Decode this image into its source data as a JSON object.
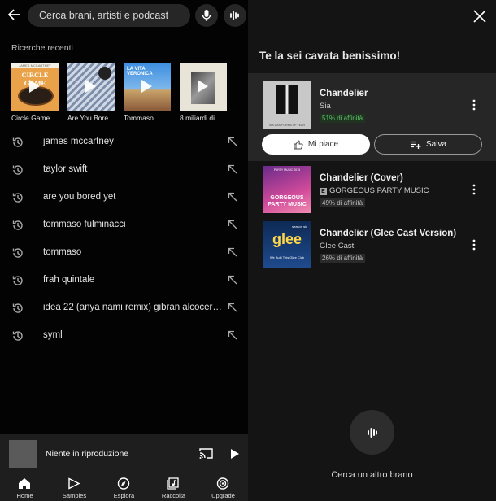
{
  "search": {
    "placeholder": "Cerca brani, artisti e podcast"
  },
  "recent": {
    "title": "Ricerche recenti",
    "albums": [
      {
        "label": "Circle Game",
        "cover_text": "CIRCLE GAME",
        "cover_small": "JAMES MCCARTNEY"
      },
      {
        "label": "Are You Bore…"
      },
      {
        "label": "Tommaso",
        "cover_text": "LA VITA VERONICA"
      },
      {
        "label": "8 miliardi di …"
      }
    ],
    "history": [
      "james mccartney",
      "taylor swift",
      "are you bored yet",
      "tommaso fulminacci",
      "tommaso",
      "frah quintale",
      "idea 22 (anya nami remix) gibran alcocer …",
      "syml"
    ]
  },
  "player": {
    "text": "Niente in riproduzione"
  },
  "nav": [
    {
      "label": "Home",
      "icon": "home-icon"
    },
    {
      "label": "Samples",
      "icon": "samples-icon"
    },
    {
      "label": "Esplora",
      "icon": "compass-icon"
    },
    {
      "label": "Raccolta",
      "icon": "library-icon"
    },
    {
      "label": "Upgrade",
      "icon": "upgrade-icon"
    }
  ],
  "recognition": {
    "title": "Te la sei cavata benissimo!",
    "results": [
      {
        "title": "Chandelier",
        "artist": "Sia",
        "affinity": "51% di affinità",
        "cover_text": "SIA 1000 FORMS OF FEAR"
      },
      {
        "title": "Chandelier (Cover)",
        "artist": "GORGEOUS PARTY MUSIC",
        "explicit": "E",
        "affinity": "49% di affinità",
        "cover_text": "GORGEOUS PARTY MUSIC",
        "cover_small": "PARTY MUSIC 2015"
      },
      {
        "title": "Chandelier (Glee Cast Version)",
        "artist": "Glee Cast",
        "affinity": "26% di affinità",
        "cover_text": "glee",
        "cover_small": "season six",
        "cover_sub": "We Built This Glee Club"
      }
    ],
    "like_label": "Mi piace",
    "save_label": "Salva",
    "another_label": "Cerca un altro brano"
  },
  "colors": {
    "affinity_green": "#5ec26a",
    "background_right": "#141414",
    "card": "#262626"
  }
}
